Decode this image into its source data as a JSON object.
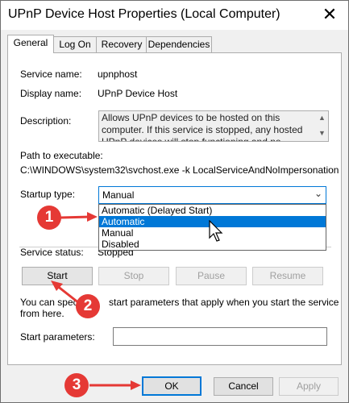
{
  "window": {
    "title": "UPnP Device Host Properties (Local Computer)",
    "close_glyph": "✕"
  },
  "tabs": [
    {
      "label": "General",
      "active": true
    },
    {
      "label": "Log On",
      "active": false
    },
    {
      "label": "Recovery",
      "active": false
    },
    {
      "label": "Dependencies",
      "active": false
    }
  ],
  "general": {
    "service_name_label": "Service name:",
    "service_name": "upnphost",
    "display_name_label": "Display name:",
    "display_name": "UPnP Device Host",
    "description_label": "Description:",
    "description": "Allows UPnP devices to be hosted on this computer. If this service is stopped, any hosted UPnP devices will stop functioning and no additional hosted",
    "path_label": "Path to executable:",
    "path": "C:\\WINDOWS\\system32\\svchost.exe -k LocalServiceAndNoImpersonation",
    "startup_type_label": "Startup type:",
    "startup_type_value": "Manual",
    "startup_options": [
      {
        "label": "Automatic (Delayed Start)",
        "highlighted": false
      },
      {
        "label": "Automatic",
        "highlighted": true
      },
      {
        "label": "Manual",
        "highlighted": false
      },
      {
        "label": "Disabled",
        "highlighted": false
      }
    ],
    "service_status_label": "Service status:",
    "service_status": "Stopped",
    "buttons": {
      "start": "Start",
      "stop": "Stop",
      "pause": "Pause",
      "resume": "Resume"
    },
    "help_text_1": "You can speci",
    "help_text_1b": "start parameters that apply when you start the service",
    "help_text_2": "from here.",
    "start_params_label": "Start parameters:",
    "start_params_value": ""
  },
  "footer": {
    "ok": "OK",
    "cancel": "Cancel",
    "apply": "Apply"
  },
  "annotations": {
    "step1": "1",
    "step2": "2",
    "step3": "3",
    "color": "#e53935"
  }
}
